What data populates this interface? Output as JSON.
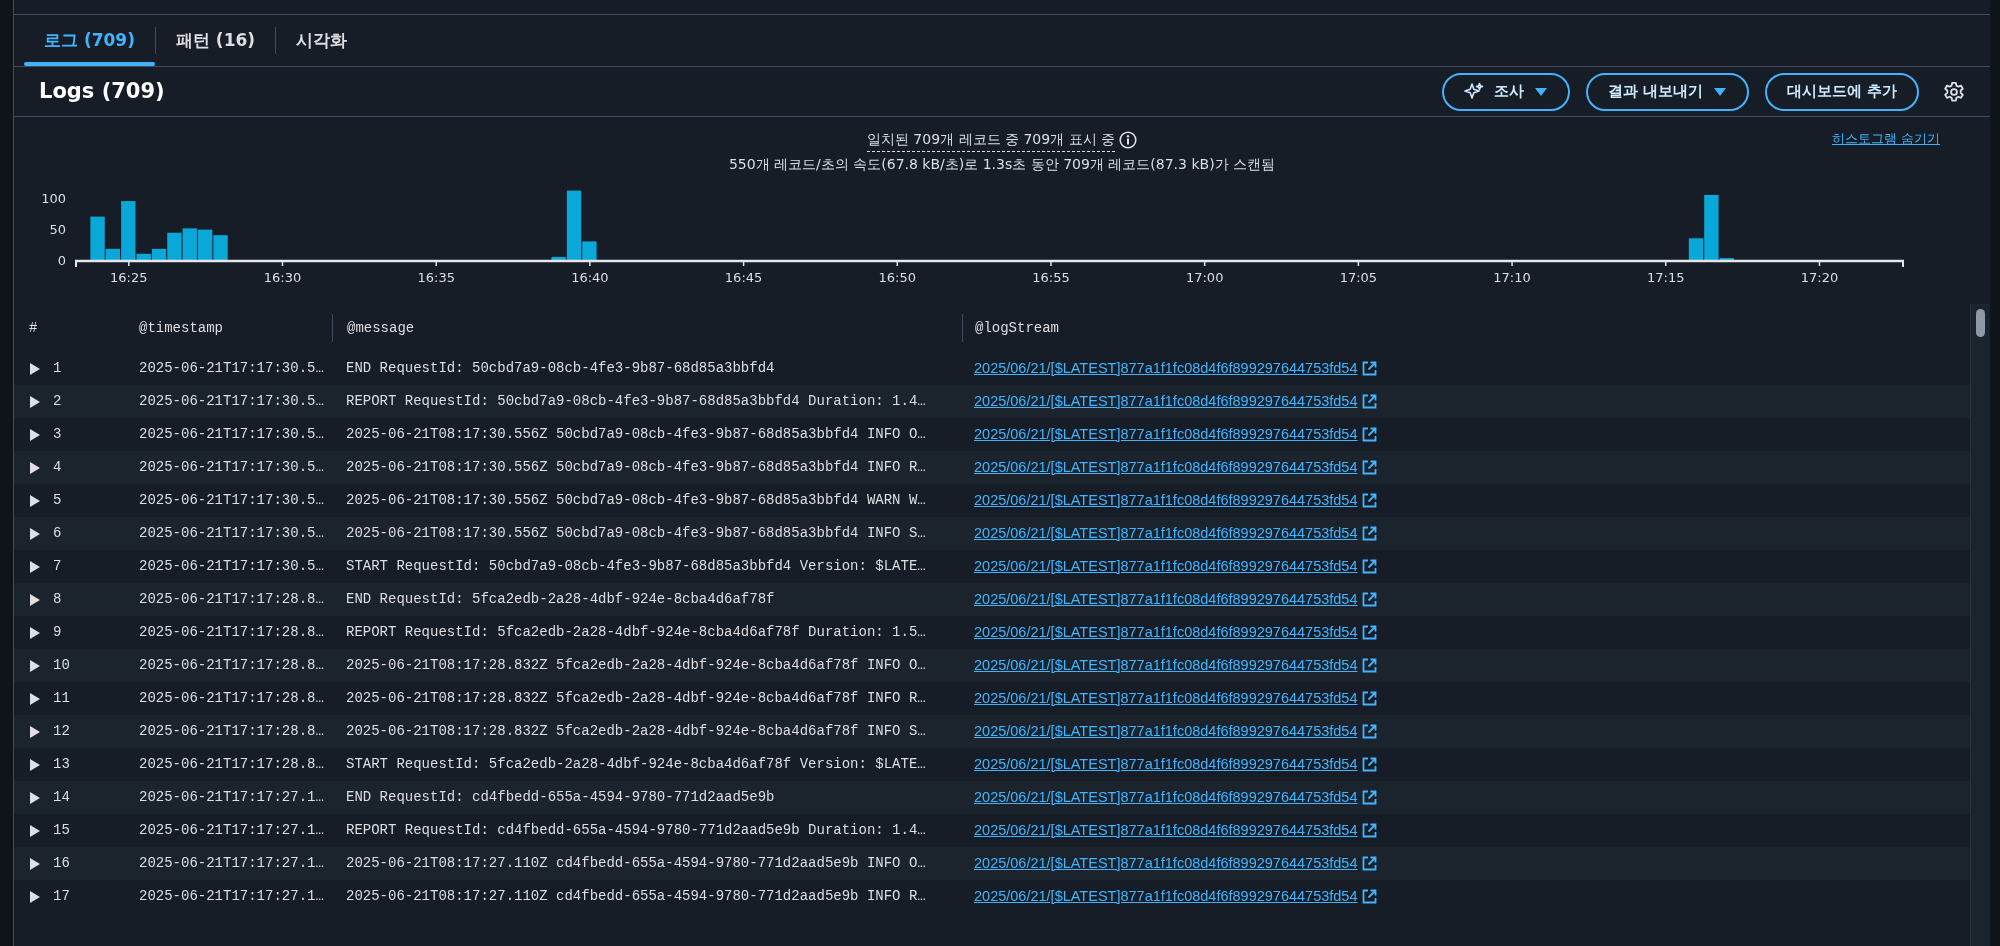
{
  "tabs": [
    {
      "label": "로그 (709)",
      "selected": true
    },
    {
      "label": "패턴 (16)",
      "selected": false
    },
    {
      "label": "시각화",
      "selected": false
    }
  ],
  "panel": {
    "title": "Logs (709)",
    "buttons": [
      {
        "label": "조사",
        "kind": "ai-dropdown"
      },
      {
        "label": "결과 내보내기",
        "kind": "dropdown"
      },
      {
        "label": "대시보드에 추가",
        "kind": "plain"
      }
    ]
  },
  "summary": {
    "matched": "일치된 709개 레코드 중 709개 표시 중",
    "scanned": "550개 레코드/초의 속도(67.8 kB/초)로 1.3s초 동안 709개 레코드(87.3 kB)가 스캔됨",
    "hide_link": "히스토그램 숨기기"
  },
  "histogram": {
    "chart_data": {
      "type": "bar",
      "categories": [
        null,
        null,
        null,
        "16:25",
        null,
        null,
        null,
        null,
        null,
        null,
        null,
        null,
        null,
        "16:30",
        null,
        null,
        null,
        null,
        null,
        null,
        null,
        null,
        null,
        "16:35",
        null,
        null,
        null,
        null,
        null,
        null,
        null,
        null,
        null,
        "16:40",
        null,
        null,
        null,
        null,
        null,
        null,
        null,
        null,
        null,
        "16:45",
        null,
        null,
        null,
        null,
        null,
        null,
        null,
        null,
        null,
        "16:50",
        null,
        null,
        null,
        null,
        null,
        null,
        null,
        null,
        null,
        "16:55",
        null,
        null,
        null,
        null,
        null,
        null,
        null,
        null,
        null,
        "17:00",
        null,
        null,
        null,
        null,
        null,
        null,
        null,
        null,
        null,
        "17:05",
        null,
        null,
        null,
        null,
        null,
        null,
        null,
        null,
        null,
        "17:10",
        null,
        null,
        null,
        null,
        null,
        null,
        null,
        null,
        null,
        "17:15",
        null,
        null,
        null,
        null,
        null,
        null,
        null,
        null,
        null,
        "17:20",
        null,
        null,
        null,
        null,
        null
      ],
      "values": [
        null,
        70,
        18,
        95,
        10,
        18,
        44,
        51,
        49,
        40,
        null,
        null,
        null,
        null,
        null,
        null,
        null,
        null,
        null,
        null,
        null,
        null,
        null,
        null,
        null,
        null,
        null,
        null,
        null,
        null,
        null,
        5,
        112,
        30,
        null,
        null,
        null,
        null,
        null,
        null,
        null,
        null,
        null,
        null,
        null,
        null,
        null,
        null,
        null,
        null,
        null,
        null,
        null,
        null,
        null,
        null,
        null,
        null,
        null,
        null,
        null,
        null,
        null,
        null,
        null,
        null,
        null,
        null,
        null,
        null,
        null,
        null,
        null,
        null,
        null,
        null,
        null,
        null,
        null,
        null,
        null,
        null,
        null,
        null,
        null,
        null,
        null,
        null,
        null,
        null,
        null,
        null,
        null,
        null,
        null,
        null,
        null,
        null,
        null,
        null,
        null,
        null,
        null,
        null,
        null,
        35,
        105,
        3,
        null,
        null,
        null,
        null,
        null,
        null,
        null,
        null,
        null,
        null,
        null
      ],
      "ylim": [
        0,
        120
      ],
      "yticks": [
        0,
        50,
        100
      ]
    }
  },
  "table": {
    "columns": [
      "#",
      "@timestamp",
      "@message",
      "@logStream"
    ],
    "rows": [
      {
        "index": "1",
        "timestamp": "2025-06-21T17:17:30.5…",
        "message": "END RequestId: 50cbd7a9-08cb-4fe3-9b87-68d85a3bbfd4",
        "log_stream": "2025/06/21/[$LATEST]877a1f1fc08d4f6f899297644753fd54",
        "expanded": false
      },
      {
        "index": "2",
        "timestamp": "2025-06-21T17:17:30.5…",
        "message": "REPORT RequestId: 50cbd7a9-08cb-4fe3-9b87-68d85a3bbfd4 Duration: 1.4…",
        "log_stream": "2025/06/21/[$LATEST]877a1f1fc08d4f6f899297644753fd54",
        "expanded": false
      },
      {
        "index": "3",
        "timestamp": "2025-06-21T17:17:30.5…",
        "message": "2025-06-21T08:17:30.556Z 50cbd7a9-08cb-4fe3-9b87-68d85a3bbfd4 INFO O…",
        "log_stream": "2025/06/21/[$LATEST]877a1f1fc08d4f6f899297644753fd54",
        "expanded": false
      },
      {
        "index": "4",
        "timestamp": "2025-06-21T17:17:30.5…",
        "message": "2025-06-21T08:17:30.556Z 50cbd7a9-08cb-4fe3-9b87-68d85a3bbfd4 INFO R…",
        "log_stream": "2025/06/21/[$LATEST]877a1f1fc08d4f6f899297644753fd54",
        "expanded": false
      },
      {
        "index": "5",
        "timestamp": "2025-06-21T17:17:30.5…",
        "message": "2025-06-21T08:17:30.556Z 50cbd7a9-08cb-4fe3-9b87-68d85a3bbfd4 WARN W…",
        "log_stream": "2025/06/21/[$LATEST]877a1f1fc08d4f6f899297644753fd54",
        "expanded": false
      },
      {
        "index": "6",
        "timestamp": "2025-06-21T17:17:30.5…",
        "message": "2025-06-21T08:17:30.556Z 50cbd7a9-08cb-4fe3-9b87-68d85a3bbfd4 INFO S…",
        "log_stream": "2025/06/21/[$LATEST]877a1f1fc08d4f6f899297644753fd54",
        "expanded": false
      },
      {
        "index": "7",
        "timestamp": "2025-06-21T17:17:30.5…",
        "message": "START RequestId: 50cbd7a9-08cb-4fe3-9b87-68d85a3bbfd4 Version: $LATE…",
        "log_stream": "2025/06/21/[$LATEST]877a1f1fc08d4f6f899297644753fd54",
        "expanded": false
      },
      {
        "index": "8",
        "timestamp": "2025-06-21T17:17:28.8…",
        "message": "END RequestId: 5fca2edb-2a28-4dbf-924e-8cba4d6af78f",
        "log_stream": "2025/06/21/[$LATEST]877a1f1fc08d4f6f899297644753fd54",
        "expanded": false
      },
      {
        "index": "9",
        "timestamp": "2025-06-21T17:17:28.8…",
        "message": "REPORT RequestId: 5fca2edb-2a28-4dbf-924e-8cba4d6af78f Duration: 1.5…",
        "log_stream": "2025/06/21/[$LATEST]877a1f1fc08d4f6f899297644753fd54",
        "expanded": false
      },
      {
        "index": "10",
        "timestamp": "2025-06-21T17:17:28.8…",
        "message": "2025-06-21T08:17:28.832Z 5fca2edb-2a28-4dbf-924e-8cba4d6af78f INFO O…",
        "log_stream": "2025/06/21/[$LATEST]877a1f1fc08d4f6f899297644753fd54",
        "expanded": false
      },
      {
        "index": "11",
        "timestamp": "2025-06-21T17:17:28.8…",
        "message": "2025-06-21T08:17:28.832Z 5fca2edb-2a28-4dbf-924e-8cba4d6af78f INFO R…",
        "log_stream": "2025/06/21/[$LATEST]877a1f1fc08d4f6f899297644753fd54",
        "expanded": false
      },
      {
        "index": "12",
        "timestamp": "2025-06-21T17:17:28.8…",
        "message": "2025-06-21T08:17:28.832Z 5fca2edb-2a28-4dbf-924e-8cba4d6af78f INFO S…",
        "log_stream": "2025/06/21/[$LATEST]877a1f1fc08d4f6f899297644753fd54",
        "expanded": false
      },
      {
        "index": "13",
        "timestamp": "2025-06-21T17:17:28.8…",
        "message": "START RequestId: 5fca2edb-2a28-4dbf-924e-8cba4d6af78f Version: $LATE…",
        "log_stream": "2025/06/21/[$LATEST]877a1f1fc08d4f6f899297644753fd54",
        "expanded": false
      },
      {
        "index": "14",
        "timestamp": "2025-06-21T17:17:27.1…",
        "message": "END RequestId: cd4fbedd-655a-4594-9780-771d2aad5e9b",
        "log_stream": "2025/06/21/[$LATEST]877a1f1fc08d4f6f899297644753fd54",
        "expanded": false
      },
      {
        "index": "15",
        "timestamp": "2025-06-21T17:17:27.1…",
        "message": "REPORT RequestId: cd4fbedd-655a-4594-9780-771d2aad5e9b Duration: 1.4…",
        "log_stream": "2025/06/21/[$LATEST]877a1f1fc08d4f6f899297644753fd54",
        "expanded": false
      },
      {
        "index": "16",
        "timestamp": "2025-06-21T17:17:27.1…",
        "message": "2025-06-21T08:17:27.110Z cd4fbedd-655a-4594-9780-771d2aad5e9b INFO O…",
        "log_stream": "2025/06/21/[$LATEST]877a1f1fc08d4f6f899297644753fd54",
        "expanded": false
      },
      {
        "index": "17",
        "timestamp": "2025-06-21T17:17:27.1…",
        "message": "2025-06-21T08:17:27.110Z cd4fbedd-655a-4594-9780-771d2aad5e9b INFO R…",
        "log_stream": "2025/06/21/[$LATEST]877a1f1fc08d4f6f899297644753fd54",
        "expanded": false
      }
    ]
  }
}
